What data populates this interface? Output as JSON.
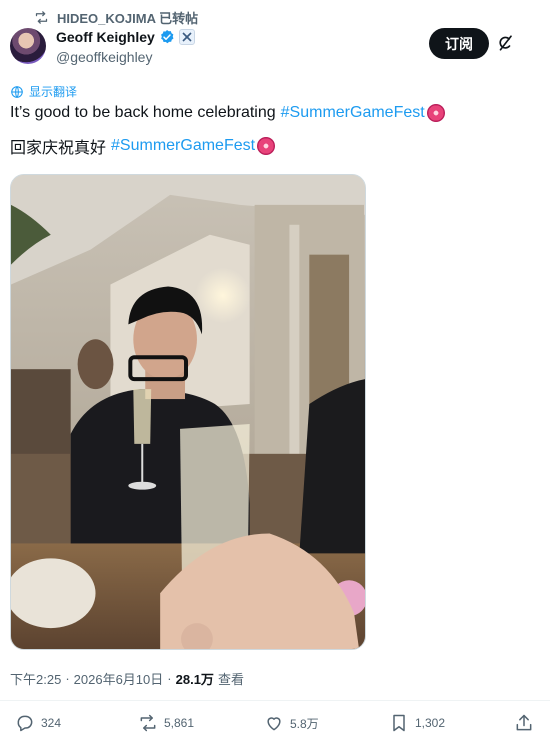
{
  "repost": {
    "label": "HIDEO_KOJIMA 已转帖"
  },
  "author": {
    "display_name": "Geoff Keighley",
    "handle": "@geoffkeighley"
  },
  "header": {
    "subscribe_label": "订阅"
  },
  "translate": {
    "label": "显示翻译"
  },
  "tweet": {
    "line1": "It’s good to be back home celebrating",
    "line2": "回家庆祝真好",
    "hashtag": "#SummerGameFest"
  },
  "meta": {
    "time": "下午2:25",
    "date": "2026年6月10日",
    "separator": "·",
    "views_count": "28.1万",
    "views_label": "查看"
  },
  "actions": {
    "replies": "324",
    "reposts": "5,861",
    "likes": "5.8万",
    "bookmarks": "1,302"
  },
  "colors": {
    "link": "#1d9bf0",
    "text": "#0f1419",
    "secondary": "#536471",
    "button_bg": "#0f1419"
  }
}
